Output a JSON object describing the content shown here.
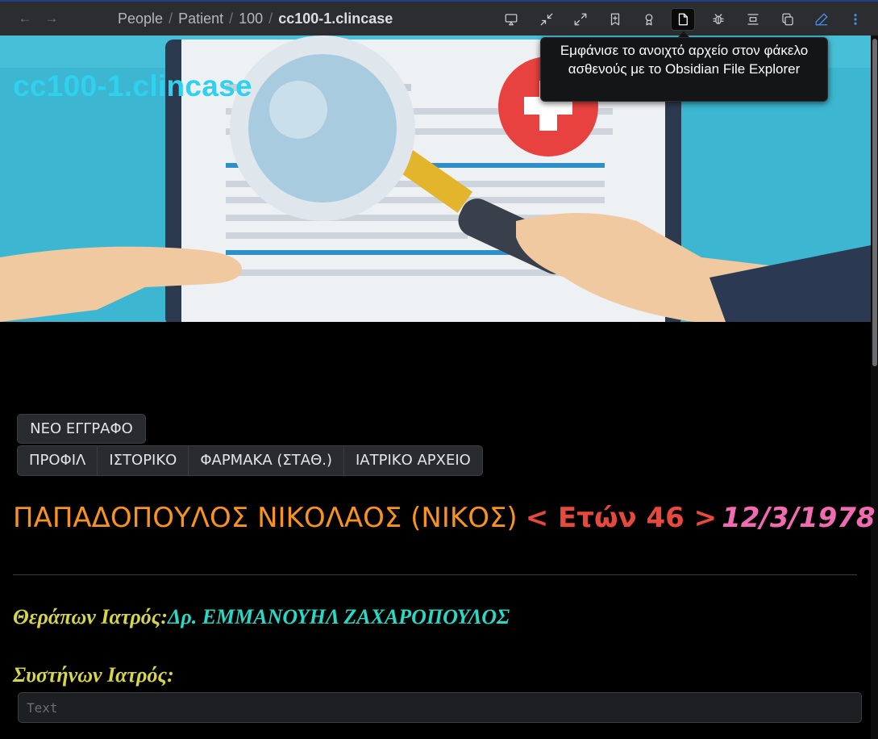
{
  "toolbar": {
    "breadcrumb": [
      "People",
      "Patient",
      "100"
    ],
    "current_file": "cc100-1.clincase",
    "back_icon": "arrow-left-icon",
    "forward_icon": "arrow-right-icon",
    "icons": [
      "cast-icon",
      "minimize-icon",
      "maximize-icon",
      "bookmark-plus-icon",
      "award-icon",
      "file-icon",
      "bug-icon",
      "align-center-icon",
      "copy-icon",
      "pencil-icon",
      "more-vertical-icon"
    ]
  },
  "tooltip": {
    "text": "Εμφάνισε το ανοιχτό αρχείο στον φάκελο ασθενούς με το Obsidian File Explorer"
  },
  "banner": {
    "title": "cc100-1.clincase"
  },
  "actions": {
    "new_document": "ΝΕΟ ΕΓΓΡΑΦΟ"
  },
  "tabs": [
    {
      "label": "ΠΡΟΦΙΛ"
    },
    {
      "label": "ΙΣΤΟΡΙΚΟ"
    },
    {
      "label": "ΦΑΡΜΑΚΑ (ΣΤΑΘ.)"
    },
    {
      "label": "ΙΑΤΡΙΚΟ ΑΡΧΕΙΟ"
    }
  ],
  "patient": {
    "name": "ΠΑΠΑΔΟΠΟΥΛΟΣ ΝΙΚΟΛΑΟΣ (ΝΙΚΟΣ)",
    "age": "< Ετών 46 >",
    "dob": "12/3/1978"
  },
  "doctor": {
    "label": "Θεράπων Ιατρός:",
    "value": "Δρ. ΕΜΜΑΝΟΥΗΛ ΖΑΧΑΡΟΠΟΥΛΟΣ"
  },
  "referrer": {
    "label": "Συστήνων Ιατρός:",
    "placeholder": "Text",
    "value": ""
  },
  "colors": {
    "name": "#f7931e",
    "age": "#e8493e",
    "dob": "#f06bb0",
    "label": "#d7d64a",
    "doctor": "#2ad8c4",
    "accent": "#4a8de8"
  }
}
